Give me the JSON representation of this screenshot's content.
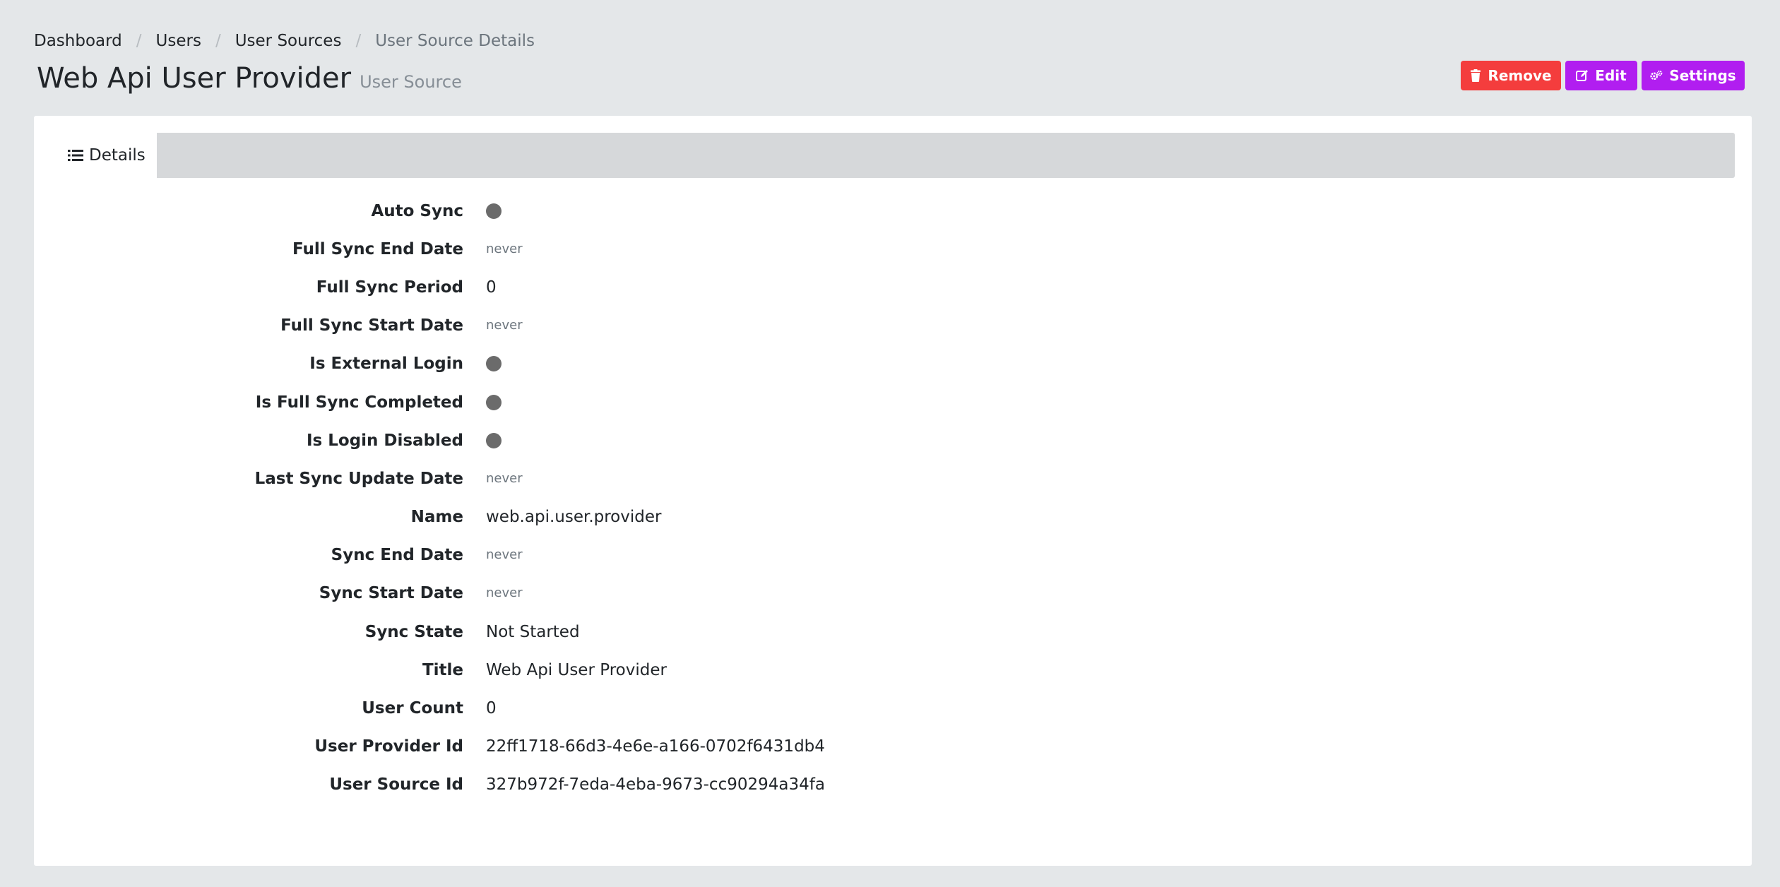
{
  "breadcrumb": {
    "items": [
      "Dashboard",
      "Users",
      "User Sources"
    ],
    "current": "User Source Details"
  },
  "header": {
    "title": "Web Api User Provider",
    "subtitle": "User Source"
  },
  "actions": {
    "remove_label": "Remove",
    "edit_label": "Edit",
    "settings_label": "Settings",
    "remove_color": "#f43d3d",
    "primary_color": "#b11ef0"
  },
  "tabs": {
    "details_label": "Details"
  },
  "details": {
    "auto_sync": {
      "label": "Auto Sync",
      "state": "off"
    },
    "full_sync_end_date": {
      "label": "Full Sync End Date",
      "value": "never"
    },
    "full_sync_period": {
      "label": "Full Sync Period",
      "value": "0"
    },
    "full_sync_start_date": {
      "label": "Full Sync Start Date",
      "value": "never"
    },
    "is_external_login": {
      "label": "Is External Login",
      "state": "off"
    },
    "is_full_sync_completed": {
      "label": "Is Full Sync Completed",
      "state": "off"
    },
    "is_login_disabled": {
      "label": "Is Login Disabled",
      "state": "off"
    },
    "last_sync_update_date": {
      "label": "Last Sync Update Date",
      "value": "never"
    },
    "name": {
      "label": "Name",
      "value": "web.api.user.provider"
    },
    "sync_end_date": {
      "label": "Sync End Date",
      "value": "never"
    },
    "sync_start_date": {
      "label": "Sync Start Date",
      "value": "never"
    },
    "sync_state": {
      "label": "Sync State",
      "value": "Not Started"
    },
    "title": {
      "label": "Title",
      "value": "Web Api User Provider"
    },
    "user_count": {
      "label": "User Count",
      "value": "0"
    },
    "user_provider_id": {
      "label": "User Provider Id",
      "value": "22ff1718-66d3-4e6e-a166-0702f6431db4"
    },
    "user_source_id": {
      "label": "User Source Id",
      "value": "327b972f-7eda-4eba-9673-cc90294a34fa"
    }
  }
}
